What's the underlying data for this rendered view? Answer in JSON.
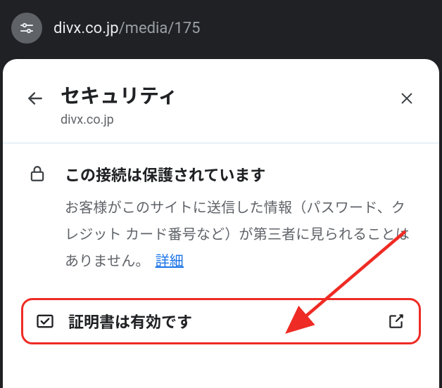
{
  "address": {
    "domain": "divx.co.jp",
    "path": "/media/175"
  },
  "panel": {
    "title": "セキュリティ",
    "domain": "divx.co.jp"
  },
  "connection": {
    "title": "この接続は保護されています",
    "body": "お客様がこのサイトに送信した情報（パスワード、クレジット カード番号など）が第三者に見られることはありません。",
    "details_label": "詳細"
  },
  "certificate": {
    "label": "証明書は有効です"
  }
}
